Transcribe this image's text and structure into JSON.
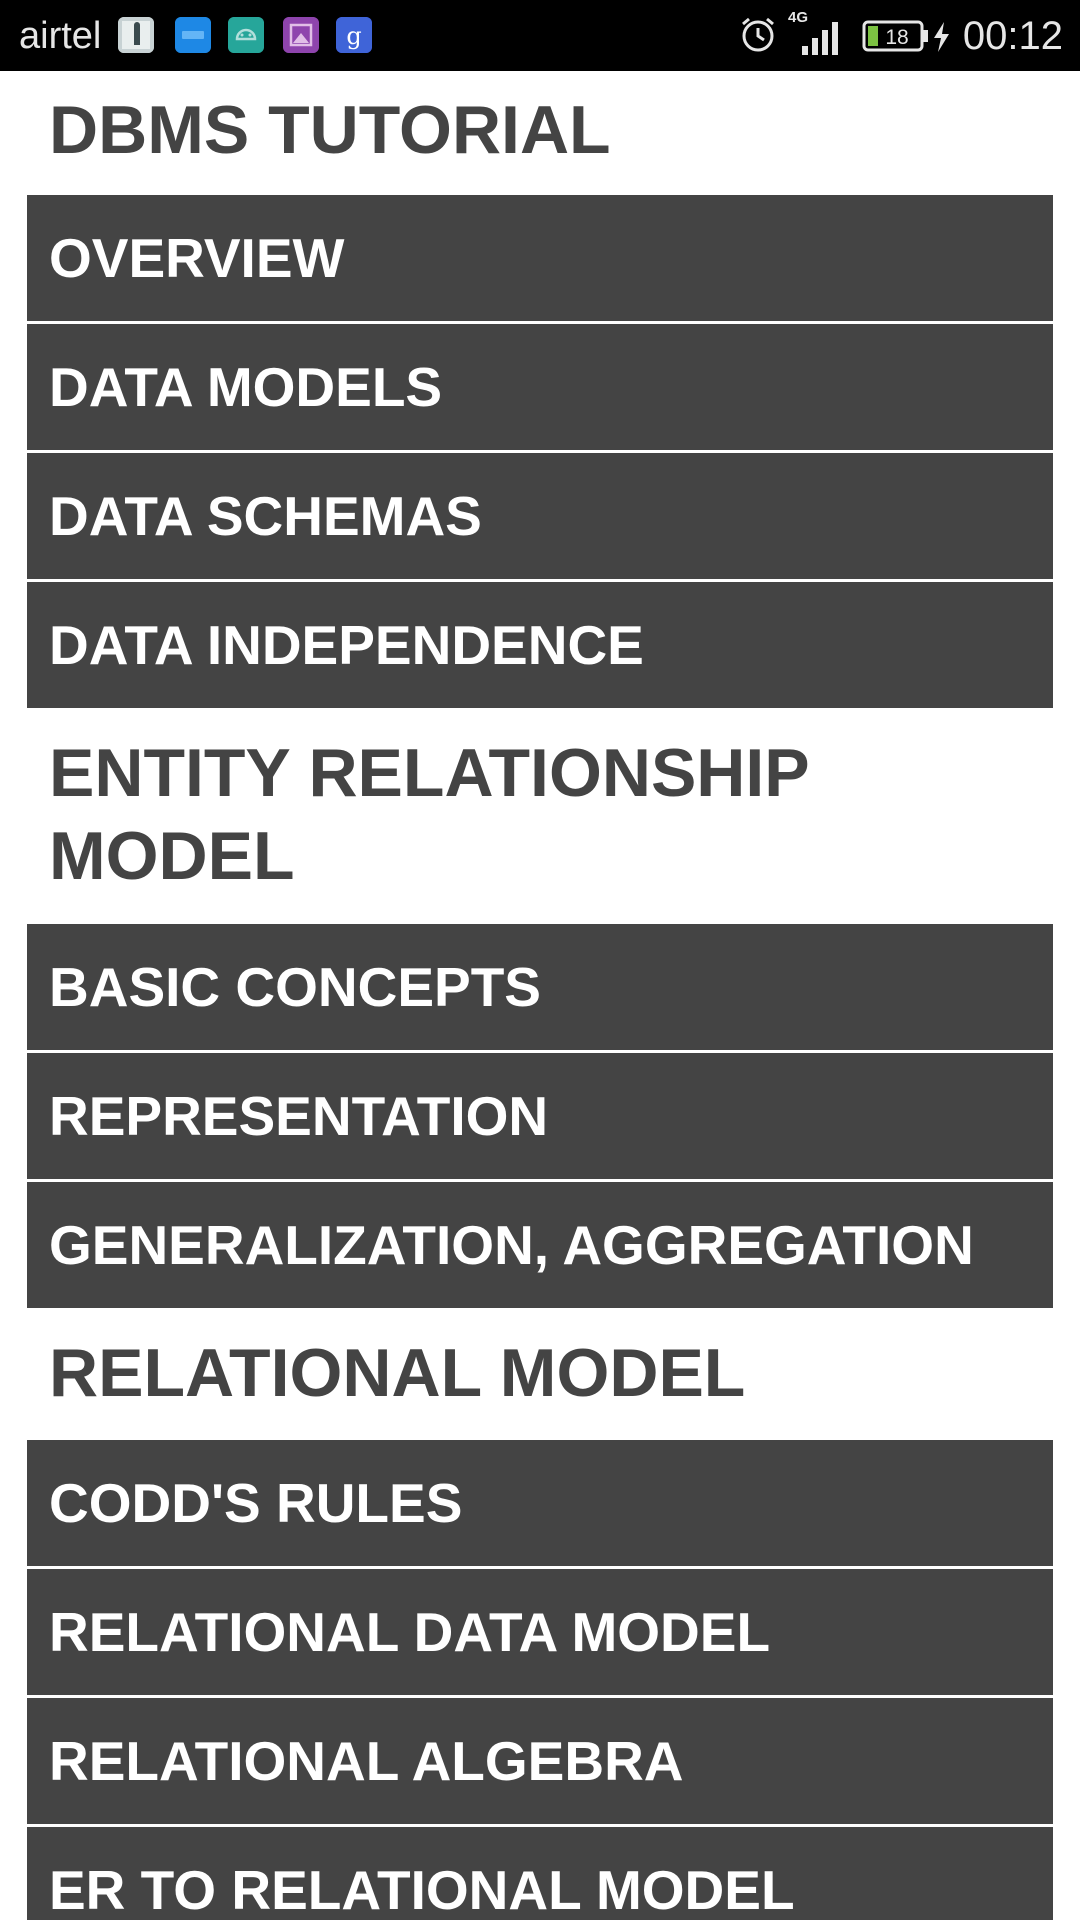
{
  "status_bar": {
    "carrier": "airtel",
    "network": "4G",
    "battery_level": "18",
    "time": "00:12",
    "notification_icons": [
      "photo-thumbnail-icon",
      "app-icon-blue",
      "android-icon",
      "gallery-icon",
      "google-icon"
    ],
    "system_icons": [
      "alarm-icon",
      "signal-icon",
      "battery-icon",
      "charging-icon"
    ]
  },
  "sections": [
    {
      "title": "DBMS TUTORIAL",
      "items": [
        "OVERVIEW",
        "DATA MODELS",
        "DATA SCHEMAS",
        "DATA INDEPENDENCE"
      ]
    },
    {
      "title_line1": "ENTITY RELATIONSHIP",
      "title_line2": "MODEL",
      "items": [
        "BASIC CONCEPTS",
        "REPRESENTATION",
        "GENERALIZATION, AGGREGATION"
      ]
    },
    {
      "title": "RELATIONAL MODEL",
      "items": [
        "CODD'S RULES",
        "RELATIONAL DATA MODEL",
        "RELATIONAL ALGEBRA",
        "ER TO RELATIONAL MODEL"
      ]
    }
  ],
  "colors": {
    "item_background": "#444444",
    "item_text": "#ffffff",
    "title_text": "#444444",
    "status_background": "#000000"
  }
}
